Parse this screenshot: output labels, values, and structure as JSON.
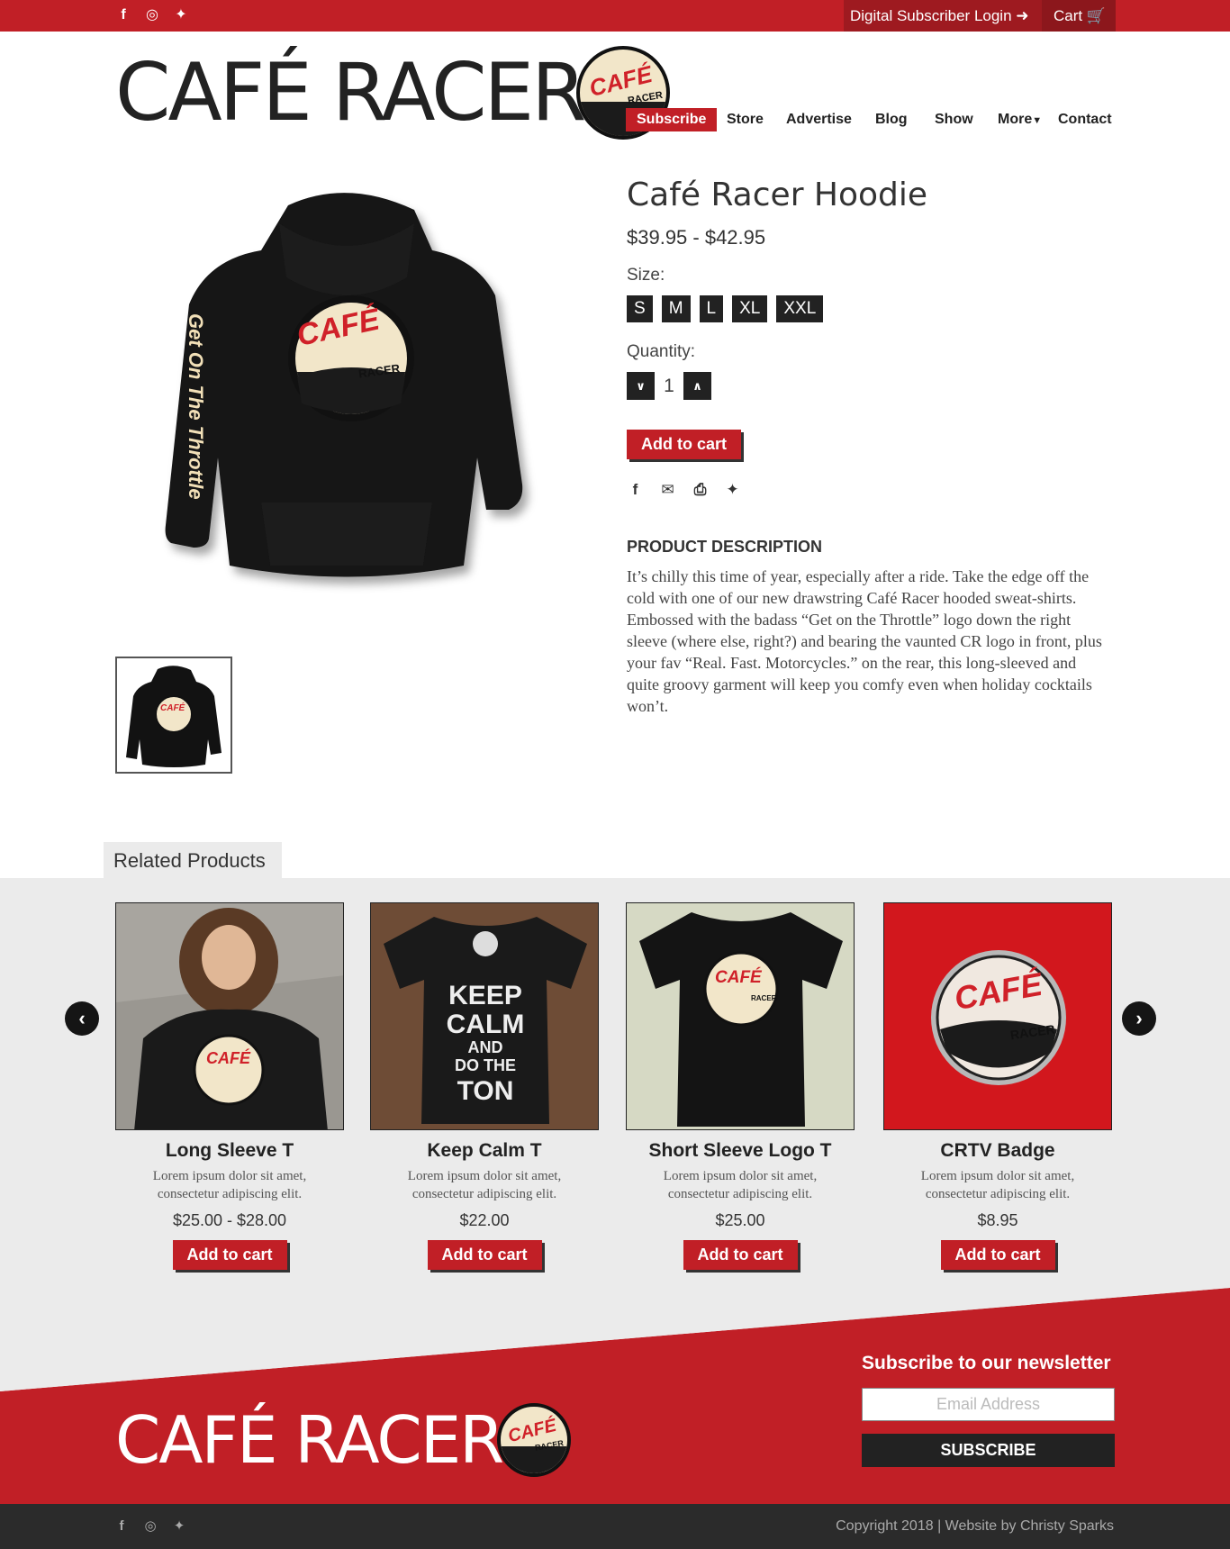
{
  "topbar": {
    "social_icons": [
      "facebook-icon",
      "instagram-icon",
      "twitter-icon"
    ],
    "login_label": "Digital Subscriber Login",
    "cart_label": "Cart"
  },
  "header": {
    "logo_text": "CAFÉ RACER",
    "nav": {
      "subscribe": "Subscribe",
      "store": "Store",
      "advertise": "Advertise",
      "blog": "Blog",
      "show": "Show",
      "more": "More",
      "contact": "Contact"
    }
  },
  "product": {
    "image_sleeve_text": "Get On The Throttle",
    "title": "Café Racer Hoodie",
    "price": "$39.95 - $42.95",
    "size_label": "Size:",
    "sizes": [
      "S",
      "M",
      "L",
      "XL",
      "XXL"
    ],
    "quantity_label": "Quantity:",
    "quantity": "1",
    "add_to_cart": "Add to cart",
    "share_icons": [
      "facebook-icon",
      "mail-icon",
      "print-icon",
      "twitter-icon"
    ],
    "description_heading": "PRODUCT DESCRIPTION",
    "description": "It’s chilly this time of year, especially after a ride. Take the edge off the cold with one of our new drawstring Café Racer hooded sweat-shirts. Embossed with the badass “Get on the Throttle” logo down the right sleeve (where else, right?) and bearing the vaunted CR logo in front, plus your fav “Real. Fast. Motorcycles.” on the rear, this long-sleeved and quite groovy garment will keep you comfy even when holiday cocktails won’t."
  },
  "related": {
    "heading": "Related Products",
    "items": [
      {
        "name": "Long Sleeve T",
        "desc": "Lorem ipsum dolor sit amet, consectetur adipiscing elit.",
        "price": "$25.00 - $28.00",
        "button": "Add to cart"
      },
      {
        "name": "Keep Calm T",
        "desc": "Lorem ipsum dolor sit amet, consectetur adipiscing elit.",
        "price": "$22.00",
        "button": "Add to cart",
        "shirt_text": [
          "KEEP",
          "CALM",
          "AND",
          "DO THE",
          "TON"
        ]
      },
      {
        "name": "Short Sleeve Logo T",
        "desc": "Lorem ipsum dolor sit amet, consectetur adipiscing elit.",
        "price": "$25.00",
        "button": "Add to cart"
      },
      {
        "name": "CRTV Badge",
        "desc": "Lorem ipsum dolor sit amet, consectetur adipiscing elit.",
        "price": "$8.95",
        "button": "Add to cart"
      }
    ]
  },
  "footer": {
    "logo_text": "CAFÉ RACER",
    "newsletter_heading": "Subscribe to our newsletter",
    "email_placeholder": "Email Address",
    "subscribe_button": "SUBSCRIBE",
    "copyright": "Copyright 2018 | Website by Christy Sparks"
  },
  "colors": {
    "brand_red": "#c11f26",
    "dark": "#222222",
    "cream": "#f2e6c9"
  }
}
